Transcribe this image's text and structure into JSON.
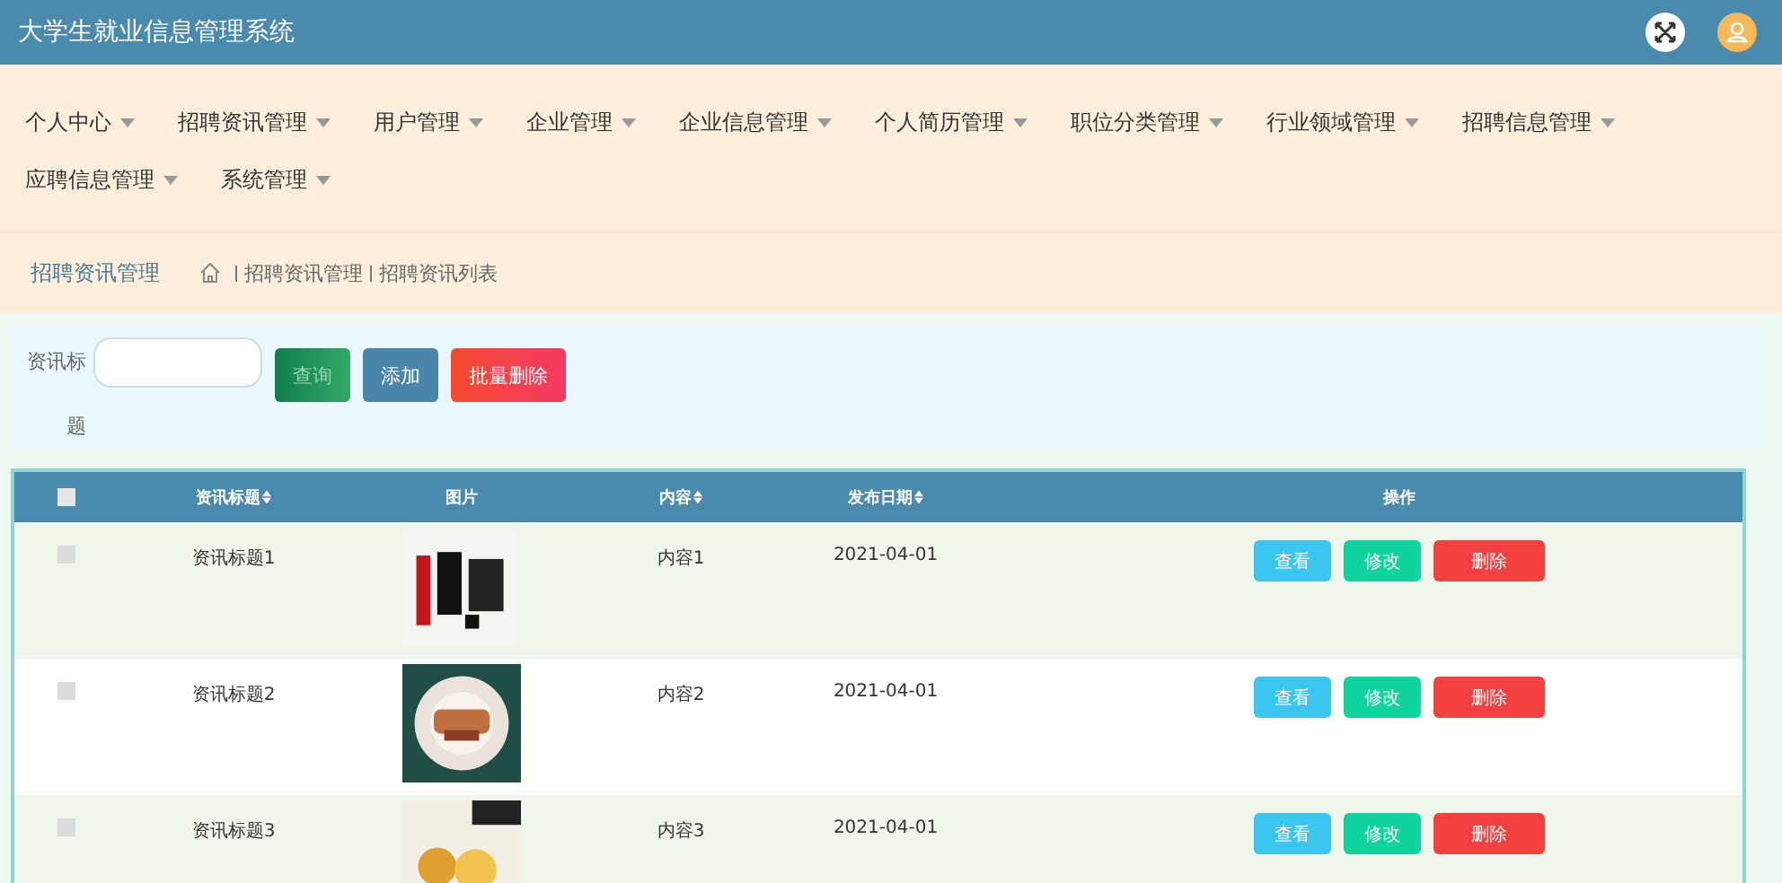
{
  "header": {
    "title": "大学生就业信息管理系统"
  },
  "nav": [
    "个人中心",
    "招聘资讯管理",
    "用户管理",
    "企业管理",
    "企业信息管理",
    "个人简历管理",
    "职位分类管理",
    "行业领域管理",
    "招聘信息管理",
    "应聘信息管理",
    "系统管理"
  ],
  "breadcrumb": {
    "title": "招聘资讯管理",
    "path": [
      "招聘资讯管理",
      "招聘资讯列表"
    ]
  },
  "search": {
    "label": "资讯标题",
    "buttons": [
      {
        "label": "查询",
        "kind": "search"
      },
      {
        "label": "添加",
        "kind": "add"
      },
      {
        "label": "批量删除",
        "kind": "delete"
      }
    ]
  },
  "table": {
    "columns": [
      {
        "label": "资讯标题",
        "sortable": true
      },
      {
        "label": "图片",
        "sortable": false
      },
      {
        "label": "内容",
        "sortable": true
      },
      {
        "label": "发布日期",
        "sortable": true
      },
      {
        "label": "操作",
        "sortable": false
      }
    ],
    "all_checked": false,
    "rows": [
      {
        "title": "资讯标题1",
        "content": "内容1",
        "date": "2021-04-01",
        "checked": false,
        "actions": [
          {
            "label": "查看",
            "kind": "view"
          },
          {
            "label": "修改",
            "kind": "edit"
          },
          {
            "label": "删除",
            "kind": "delete"
          }
        ]
      },
      {
        "title": "资讯标题2",
        "content": "内容2",
        "date": "2021-04-01",
        "checked": false,
        "actions": [
          {
            "label": "查看",
            "kind": "view"
          },
          {
            "label": "修改",
            "kind": "edit"
          },
          {
            "label": "删除",
            "kind": "delete"
          }
        ]
      },
      {
        "title": "资讯标题3",
        "content": "内容3",
        "date": "2021-04-01",
        "checked": false,
        "actions": [
          {
            "label": "查看",
            "kind": "view"
          },
          {
            "label": "修改",
            "kind": "edit"
          },
          {
            "label": "删除",
            "kind": "delete"
          }
        ]
      }
    ]
  }
}
